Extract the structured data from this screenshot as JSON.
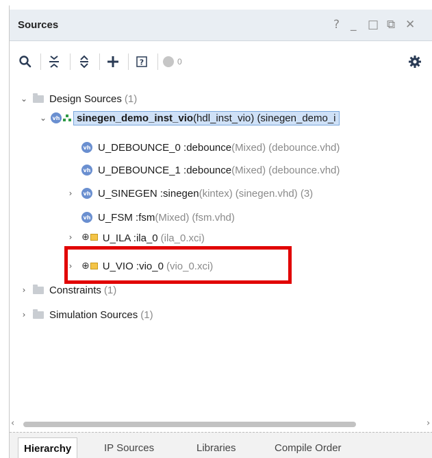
{
  "window": {
    "title": "Sources",
    "controls": [
      "?",
      "_",
      "□",
      "⧉",
      "✕"
    ]
  },
  "toolbar": {
    "search_icon": "search-icon",
    "collapse_icon": "collapse-all-icon",
    "expand_icon": "expand-all-icon",
    "add_icon": "add-icon",
    "unknown_icon": "unknown-source-icon",
    "status_count": "0",
    "settings_icon": "gear-icon"
  },
  "tree": {
    "design_sources": {
      "label": "Design Sources",
      "count": "(1)"
    },
    "top": {
      "name": "sinegen_demo_inst_vio",
      "detail": "(hdl_inst_vio) (sinegen_demo_i"
    },
    "children": [
      {
        "name": "U_DEBOUNCE_0 : ",
        "entity": "debounce",
        "arch": "(Mixed)",
        "file": "(debounce.vhd)"
      },
      {
        "name": "U_DEBOUNCE_1 : ",
        "entity": "debounce",
        "arch": "(Mixed)",
        "file": "(debounce.vhd)"
      },
      {
        "name": "U_SINEGEN : ",
        "entity": "sinegen",
        "arch": "(kintex)",
        "file": "(sinegen.vhd) (3)"
      },
      {
        "name": "U_FSM : ",
        "entity": "fsm",
        "arch": "(Mixed)",
        "file": "(fsm.vhd)"
      }
    ],
    "ip": [
      {
        "name": "U_ILA : ",
        "entity": "ila_0",
        "file": "(ila_0.xci)"
      },
      {
        "name": "U_VIO : ",
        "entity": "vio_0",
        "file": "(vio_0.xci)"
      }
    ],
    "constraints": {
      "label": "Constraints",
      "count": "(1)"
    },
    "simulation_sources": {
      "label": "Simulation Sources",
      "count": "(1)"
    }
  },
  "tabs": [
    "Hierarchy",
    "IP Sources",
    "Libraries",
    "Compile Order"
  ],
  "colors": {
    "highlight": "#e10000",
    "selection": "#cfe1f7",
    "titlebar": "#e9eef3"
  }
}
